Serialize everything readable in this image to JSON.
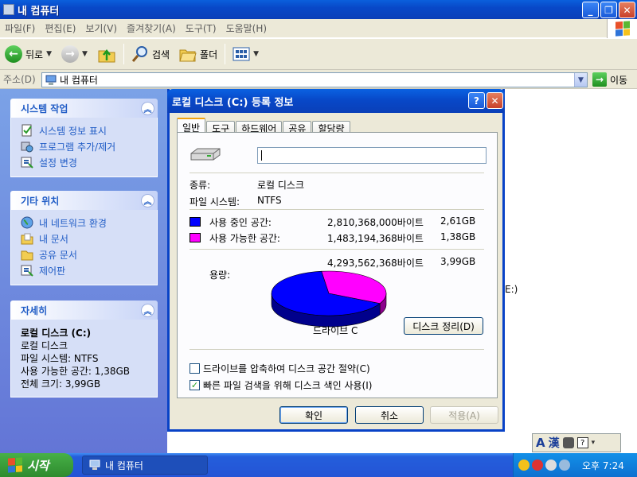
{
  "window": {
    "title": "내 컴퓨터",
    "menu": [
      "파일(F)",
      "편집(E)",
      "보기(V)",
      "즐겨찾기(A)",
      "도구(T)",
      "도움말(H)"
    ],
    "toolbar": {
      "back_label": "뒤로",
      "search_label": "검색",
      "folders_label": "폴더"
    },
    "address": {
      "label": "주소(D)",
      "value": "내 컴퓨터",
      "go_label": "이동"
    }
  },
  "task_pane": {
    "system_tasks": {
      "title": "시스템 작업",
      "items": [
        "시스템 정보 표시",
        "프로그램 추가/제거",
        "설정 변경"
      ]
    },
    "other_places": {
      "title": "기타 위치",
      "items": [
        "내 네트워크 환경",
        "내 문서",
        "공유 문서",
        "제어판"
      ]
    },
    "details": {
      "title": "자세히",
      "name": "로컬 디스크 (C:)",
      "type": "로컬 디스크",
      "fs": "파일 시스템: NTFS",
      "free": "사용 가능한 공간: 1,38GB",
      "total": "전체 크기: 3,99GB"
    }
  },
  "content": {
    "partial_label": "E:)"
  },
  "dialog": {
    "title": "로컬 디스크 (C:) 등록 정보",
    "tabs": [
      "일반",
      "도구",
      "하드웨어",
      "공유",
      "할당량"
    ],
    "active_tab": "일반",
    "volume_name": "",
    "type_label": "종류:",
    "type_value": "로컬 디스크",
    "fs_label": "파일 시스템:",
    "fs_value": "NTFS",
    "used": {
      "label": "사용 중인 공간:",
      "bytes": "2,810,368,000바이트",
      "size": "2,61GB",
      "color": "#0000ff"
    },
    "free": {
      "label": "사용 가능한 공간:",
      "bytes": "1,483,194,368바이트",
      "size": "1,38GB",
      "color": "#ff00ff"
    },
    "capacity": {
      "label": "용량:",
      "bytes": "4,293,562,368바이트",
      "size": "3,99GB"
    },
    "used_fraction": 0.6546,
    "drive_label": "드라이브 C",
    "cleanup_label": "디스크 정리(D)",
    "compress_label": "드라이브를 압축하여 디스크 공간 절약(C)",
    "compress_checked": false,
    "index_label": "빠른 파일 검색을 위해 디스크 색인 사용(I)",
    "index_checked": true,
    "buttons": {
      "ok": "확인",
      "cancel": "취소",
      "apply": "적용(A)"
    }
  },
  "taskbar": {
    "start_label": "시작",
    "task_item": "내 컴퓨터",
    "clock": "오후 7:24",
    "lang": {
      "mode": "A",
      "hanja": "漢"
    }
  }
}
